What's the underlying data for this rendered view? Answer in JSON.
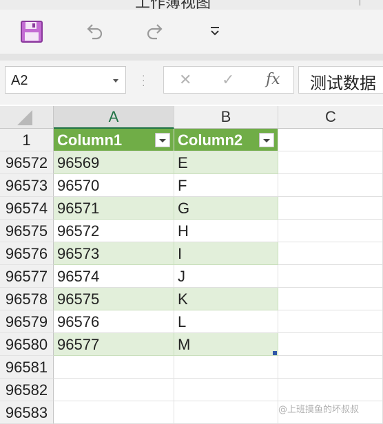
{
  "window": {
    "title": "工作簿视图"
  },
  "quick_access": {
    "save_icon": "save-icon",
    "undo_icon": "undo-icon",
    "redo_icon": "redo-icon",
    "customize_icon": "chevron-down-icon"
  },
  "formula_bar": {
    "name_box": "A2",
    "cancel_symbol": "✕",
    "enter_symbol": "✓",
    "fx_label": "fx",
    "formula_value": "测试数据"
  },
  "columns": [
    "A",
    "B",
    "C"
  ],
  "header_row_number": "1",
  "table_headers": [
    "Column1",
    "Column2"
  ],
  "rows": [
    {
      "row": "96572",
      "a": "96569",
      "b": "E"
    },
    {
      "row": "96573",
      "a": "96570",
      "b": "F"
    },
    {
      "row": "96574",
      "a": "96571",
      "b": "G"
    },
    {
      "row": "96575",
      "a": "96572",
      "b": "H"
    },
    {
      "row": "96576",
      "a": "96573",
      "b": "I"
    },
    {
      "row": "96577",
      "a": "96574",
      "b": "J"
    },
    {
      "row": "96578",
      "a": "96575",
      "b": "K"
    },
    {
      "row": "96579",
      "a": "96576",
      "b": "L"
    },
    {
      "row": "96580",
      "a": "96577",
      "b": "M"
    },
    {
      "row": "96581",
      "a": "",
      "b": ""
    },
    {
      "row": "96582",
      "a": "",
      "b": ""
    },
    {
      "row": "96583",
      "a": "",
      "b": ""
    }
  ],
  "watermark": "@上班摸鱼的坏叔叔",
  "colors": {
    "table_header": "#70ad47",
    "band": "#e2efda",
    "accent": "#217346"
  }
}
